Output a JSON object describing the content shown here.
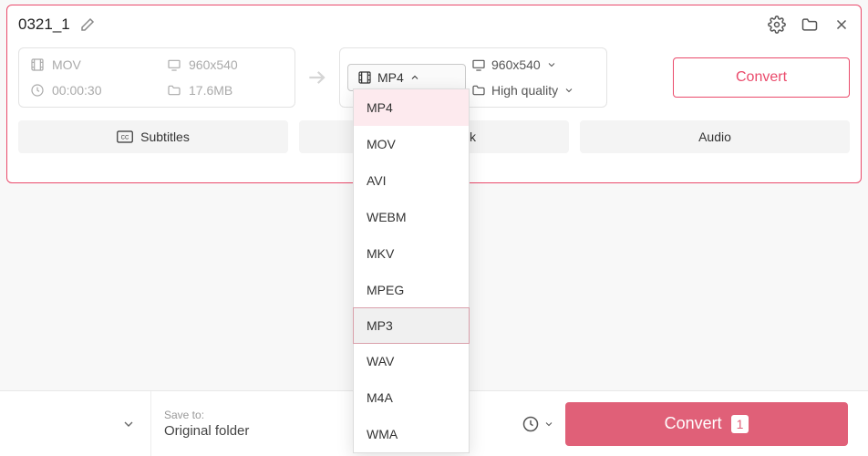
{
  "file": {
    "title": "0321_1",
    "src_format": "MOV",
    "src_resolution": "960x540",
    "duration": "00:00:30",
    "size": "17.6MB"
  },
  "output": {
    "format": "MP4",
    "resolution": "960x540",
    "quality": "High quality"
  },
  "buttons": {
    "convert_single": "Convert",
    "convert_all": "Convert",
    "count": "1"
  },
  "tabs": {
    "subtitles": "Subtitles",
    "watermark": "Watermark",
    "audio": "Audio"
  },
  "format_options": [
    "MP4",
    "MOV",
    "AVI",
    "WEBM",
    "MKV",
    "MPEG",
    "MP3",
    "WAV",
    "M4A",
    "WMA"
  ],
  "format_selected": "MP4",
  "format_hovered": "MP3",
  "footer": {
    "saveto_label": "Save to:",
    "saveto_value": "Original folder"
  }
}
